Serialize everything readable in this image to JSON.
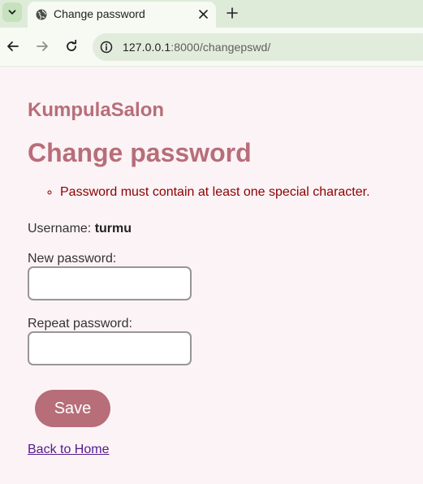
{
  "browser": {
    "tab": {
      "title": "Change password"
    },
    "address": {
      "host": "127.0.0.1",
      "rest": ":8000/changepswd/"
    }
  },
  "page": {
    "brand": "KumpulaSalon",
    "heading": "Change password",
    "errors": [
      "Password must contain at least one special character."
    ],
    "username_label": "Username:",
    "username_value": "turmu",
    "new_password_label": "New password:",
    "new_password_value": "",
    "repeat_password_label": "Repeat password:",
    "repeat_password_value": "",
    "save_label": "Save",
    "back_link": "Back to Home"
  },
  "colors": {
    "accent": "#b76e79",
    "error": "#8b0000",
    "link_visited": "#551a8b",
    "page_background": "#fcf3f6"
  },
  "icons": [
    "chevron-down-icon",
    "globe-icon",
    "close-icon",
    "plus-icon",
    "back-arrow-icon",
    "forward-arrow-icon",
    "reload-icon",
    "info-icon"
  ]
}
